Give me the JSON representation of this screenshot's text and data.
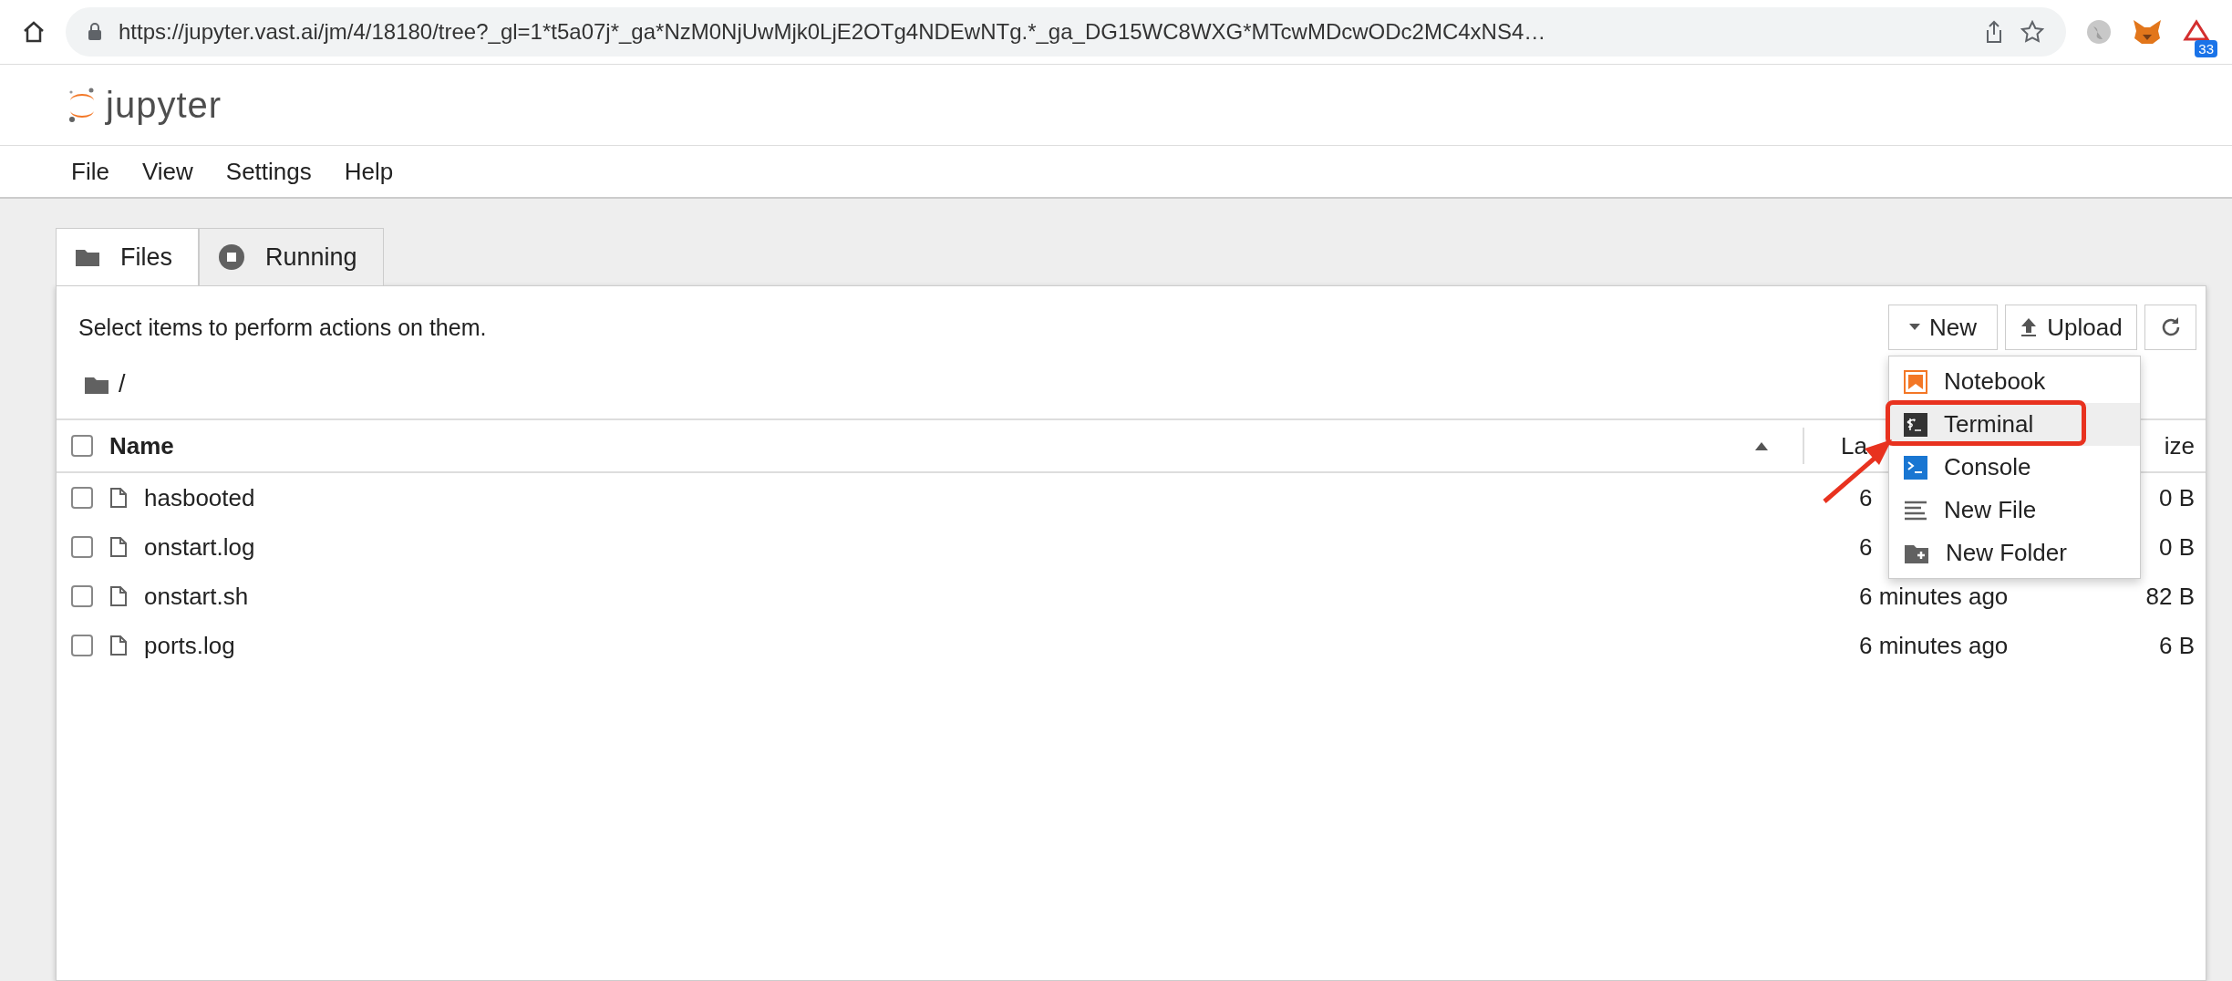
{
  "browser": {
    "url": "https://jupyter.vast.ai/jm/4/18180/tree?_gl=1*t5a07j*_ga*NzM0NjUwMjk0LjE2OTg4NDEwNTg.*_ga_DG15WC8WXG*MTcwMDcwODc2MC4xNS4…",
    "extension_badge": "33"
  },
  "app": {
    "logo": "jupyter",
    "menu": [
      "File",
      "View",
      "Settings",
      "Help"
    ]
  },
  "tabs": [
    {
      "label": "Files",
      "kind": "folder",
      "selected": true
    },
    {
      "label": "Running",
      "kind": "running",
      "selected": false
    }
  ],
  "toolbar": {
    "hint": "Select items to perform actions on them.",
    "new_button": "New",
    "upload_button": "Upload"
  },
  "breadcrumb": "/",
  "table": {
    "select_all_checked": false,
    "columns": [
      "Name",
      "La",
      "ize"
    ],
    "rows": [
      {
        "name": "hasbooted",
        "modified": "6",
        "size": "0 B",
        "checked": false
      },
      {
        "name": "onstart.log",
        "modified": "6",
        "size": "0 B",
        "checked": false
      },
      {
        "name": "onstart.sh",
        "modified": "6 minutes ago",
        "size": "82 B",
        "checked": false
      },
      {
        "name": "ports.log",
        "modified": "6 minutes ago",
        "size": "6 B",
        "checked": false
      }
    ]
  },
  "new_menu": [
    {
      "label": "Notebook",
      "kind": "notebook",
      "selected": false,
      "annotated": false
    },
    {
      "label": "Terminal",
      "kind": "terminal",
      "selected": true,
      "annotated": true
    },
    {
      "label": "Console",
      "kind": "console",
      "selected": false,
      "annotated": false
    },
    {
      "label": "New File",
      "kind": "file",
      "selected": false,
      "annotated": false
    },
    {
      "label": "New Folder",
      "kind": "folder",
      "selected": false,
      "annotated": false
    }
  ]
}
